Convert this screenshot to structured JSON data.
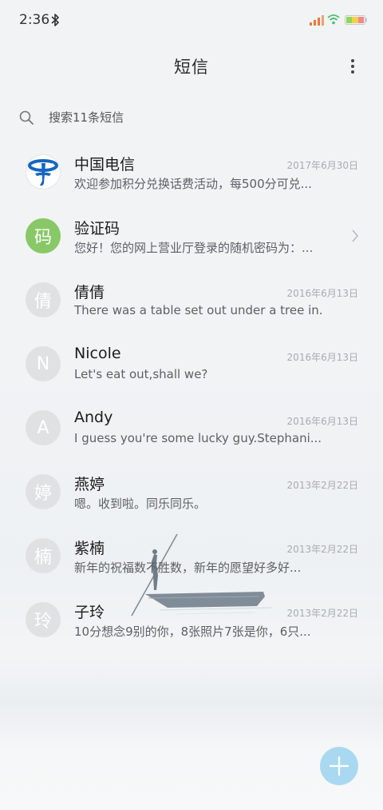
{
  "status": {
    "time": "2:36"
  },
  "header": {
    "title": "短信"
  },
  "search": {
    "placeholder": "搜索11条短信"
  },
  "conversations": [
    {
      "name": "中国电信",
      "date": "2017年6月30日",
      "preview": "欢迎参加积分兑换话费活动，每500分可兑...",
      "avatar_type": "logo",
      "avatar_icon": "china-telecom-logo"
    },
    {
      "name": "验证码",
      "date": "",
      "preview": "您好！您的网上营业厅登录的随机密码为：...",
      "avatar_type": "green",
      "avatar_text": "码",
      "has_chevron": true
    },
    {
      "name": "倩倩",
      "date": "2016年6月13日",
      "preview": "There was a table set out under a tree in...",
      "avatar_type": "grey",
      "avatar_text": "倩"
    },
    {
      "name": "Nicole",
      "date": "2016年6月13日",
      "preview": "Let's eat out,shall we?",
      "avatar_type": "grey",
      "avatar_text": "N"
    },
    {
      "name": "Andy",
      "date": "2016年6月13日",
      "preview": "I guess you're some lucky guy.Stephani...",
      "avatar_type": "grey",
      "avatar_text": "A"
    },
    {
      "name": "燕婷",
      "date": "2013年2月22日",
      "preview": "嗯。收到啦。同乐同乐。",
      "avatar_type": "grey",
      "avatar_text": "婷"
    },
    {
      "name": "紫楠",
      "date": "2013年2月22日",
      "preview": "新年的祝福数不胜数，新年的愿望好多好...",
      "avatar_type": "grey",
      "avatar_text": "楠"
    },
    {
      "name": "子玲",
      "date": "2013年2月22日",
      "preview": "10分想念9别的你，8张照片7张是你，6只...",
      "avatar_type": "grey",
      "avatar_text": "玲"
    }
  ],
  "colors": {
    "accent_green": "#88c867",
    "compose_button": "#a9d9f1",
    "telecom_blue": "#1565c0"
  }
}
